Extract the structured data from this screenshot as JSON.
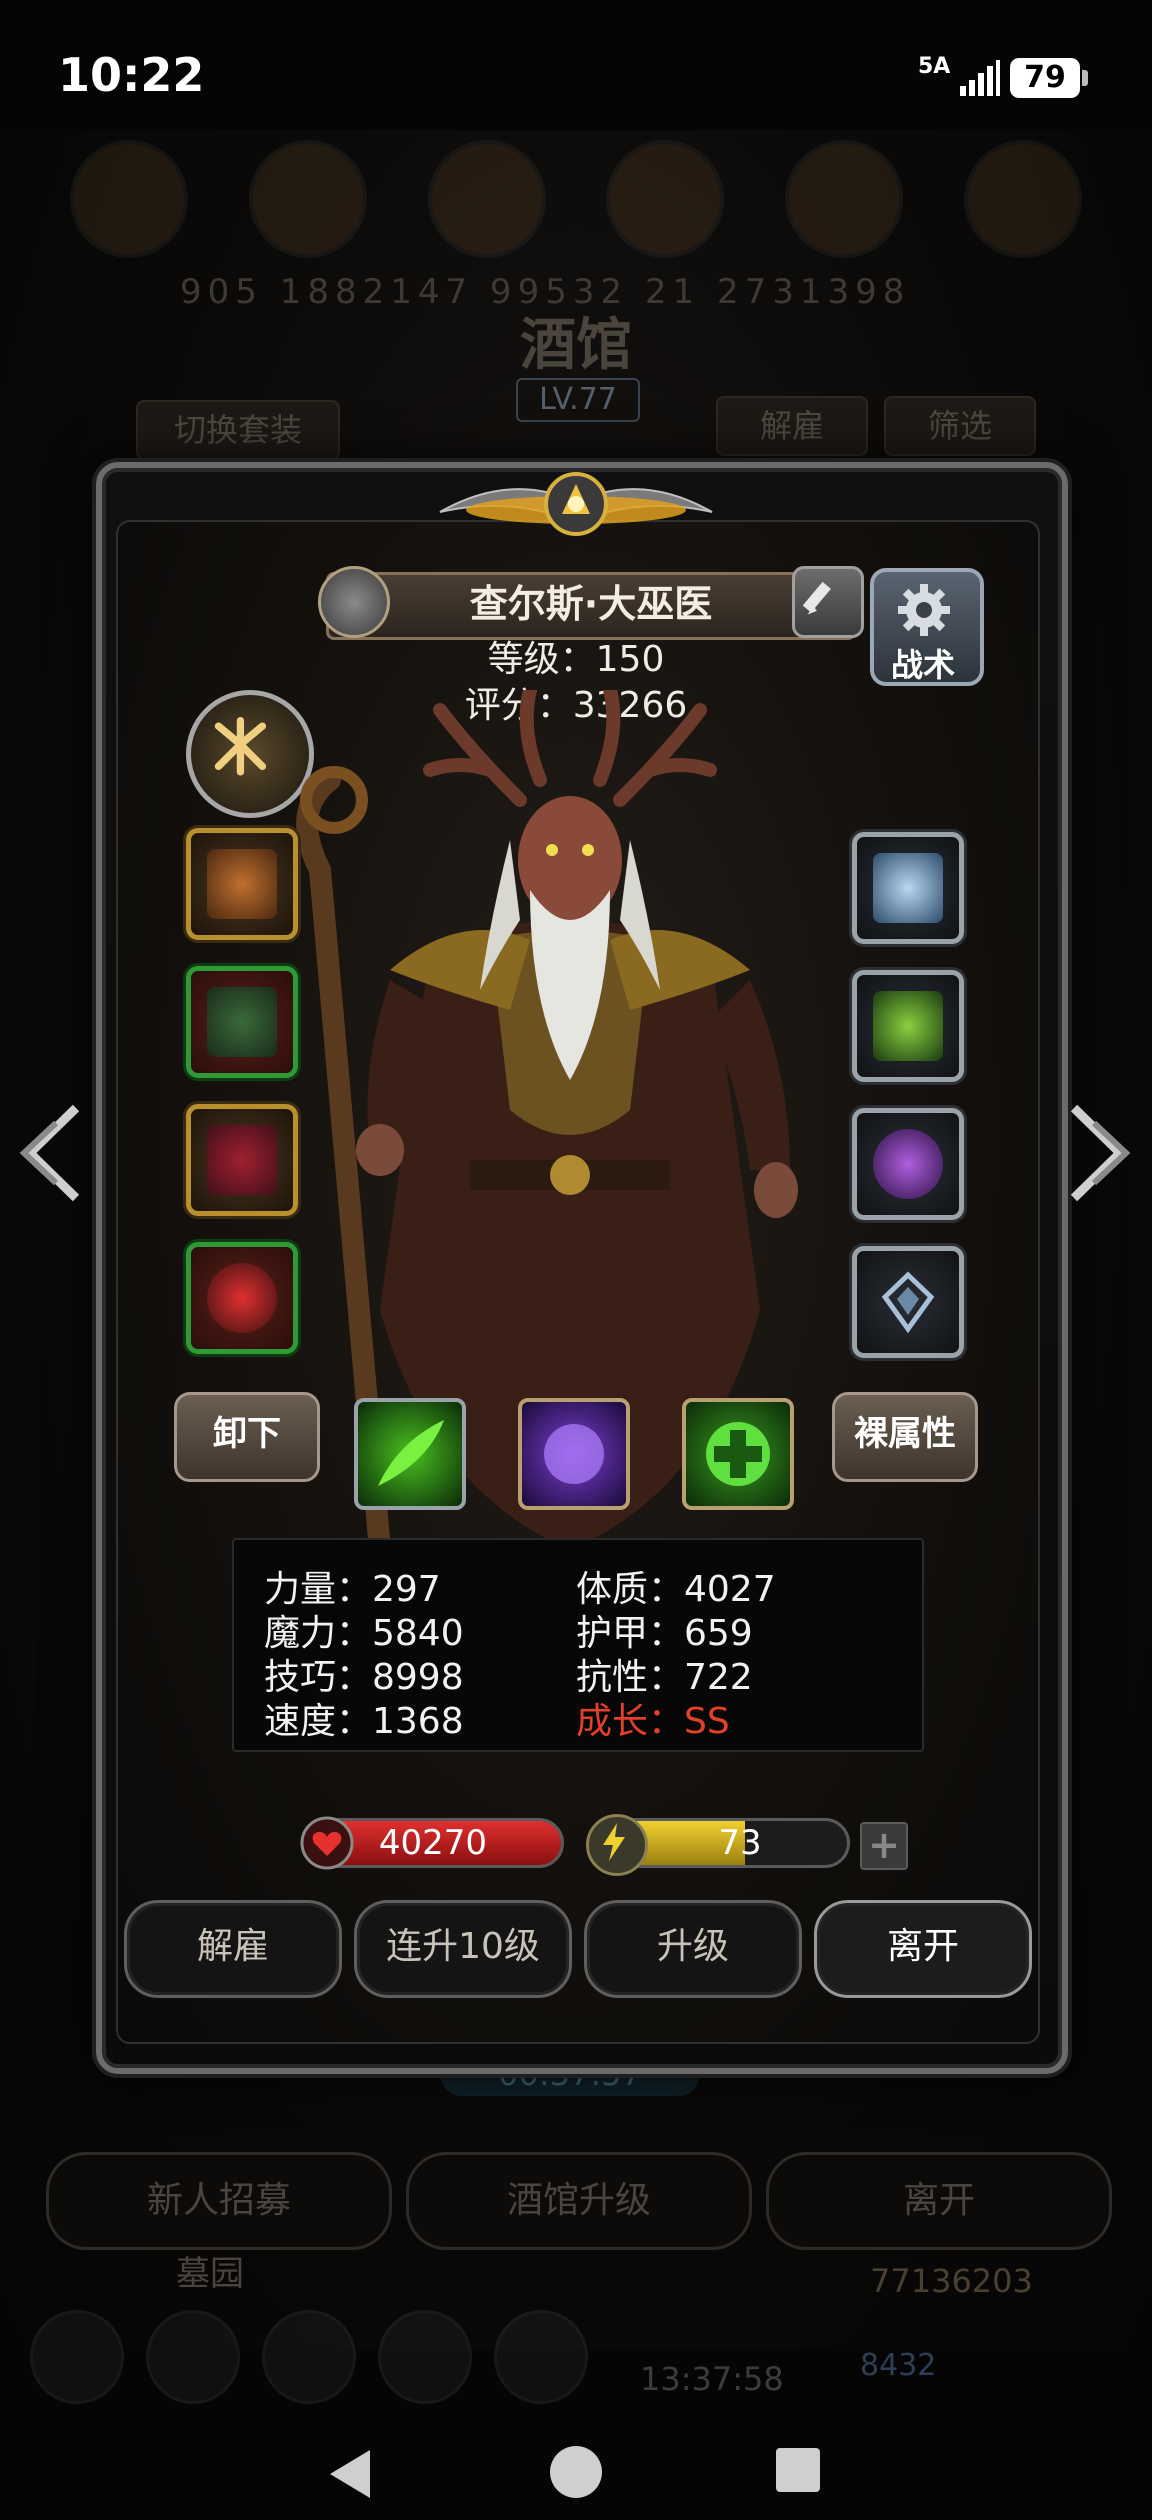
{
  "status_bar": {
    "time": "10:22",
    "network": "5A",
    "battery": "79"
  },
  "background": {
    "numbers": "905 1882147 99532 21 2731398",
    "title": "酒馆",
    "level": "LV.77",
    "switch_outfit": "切换套装",
    "dismiss": "解雇",
    "filter": "筛选",
    "timer": "00:37:57",
    "bottom_buttons": [
      "新人招募",
      "酒馆升级",
      "离开"
    ],
    "graveyard": "墓园",
    "gold": "77136203",
    "gems": "8432",
    "timer2": "13:37:58"
  },
  "hero": {
    "name": "查尔斯·大巫医",
    "level": "等级：150",
    "score": "评分：33266",
    "tactics_label": "战术"
  },
  "equipment": {
    "left": [
      {
        "name": "staff-slot",
        "quality": "gold"
      },
      {
        "name": "robe-slot",
        "quality": "green"
      },
      {
        "name": "boots-slot",
        "quality": "gold"
      },
      {
        "name": "amulet-slot",
        "quality": "green"
      }
    ],
    "right": [
      {
        "name": "crown-slot",
        "quality": "silver"
      },
      {
        "name": "crystal-slot",
        "quality": "silver"
      },
      {
        "name": "ring-slot",
        "quality": "silver"
      },
      {
        "name": "emblem-slot",
        "quality": "silver"
      }
    ]
  },
  "buttons": {
    "unequip": "卸下",
    "naked_attributes": "裸属性",
    "dismiss": "解雇",
    "level_up_10": "连升10级",
    "level_up": "升级",
    "leave": "离开"
  },
  "stats": {
    "strength": "力量：297",
    "magic": "魔力：5840",
    "skill": "技巧：8998",
    "speed": "速度：1368",
    "constitution": "体质：4027",
    "armor": "护甲：659",
    "resistance": "抗性：722",
    "growth_label": "成长：",
    "growth_value": "SS"
  },
  "bars": {
    "hp": "40270",
    "energy": "73",
    "energy_fraction": 0.6,
    "plus": "+"
  },
  "colors": {
    "gold_frame": "#b8902e",
    "green_frame": "#2f9a35",
    "growth_red": "#e3402a"
  }
}
